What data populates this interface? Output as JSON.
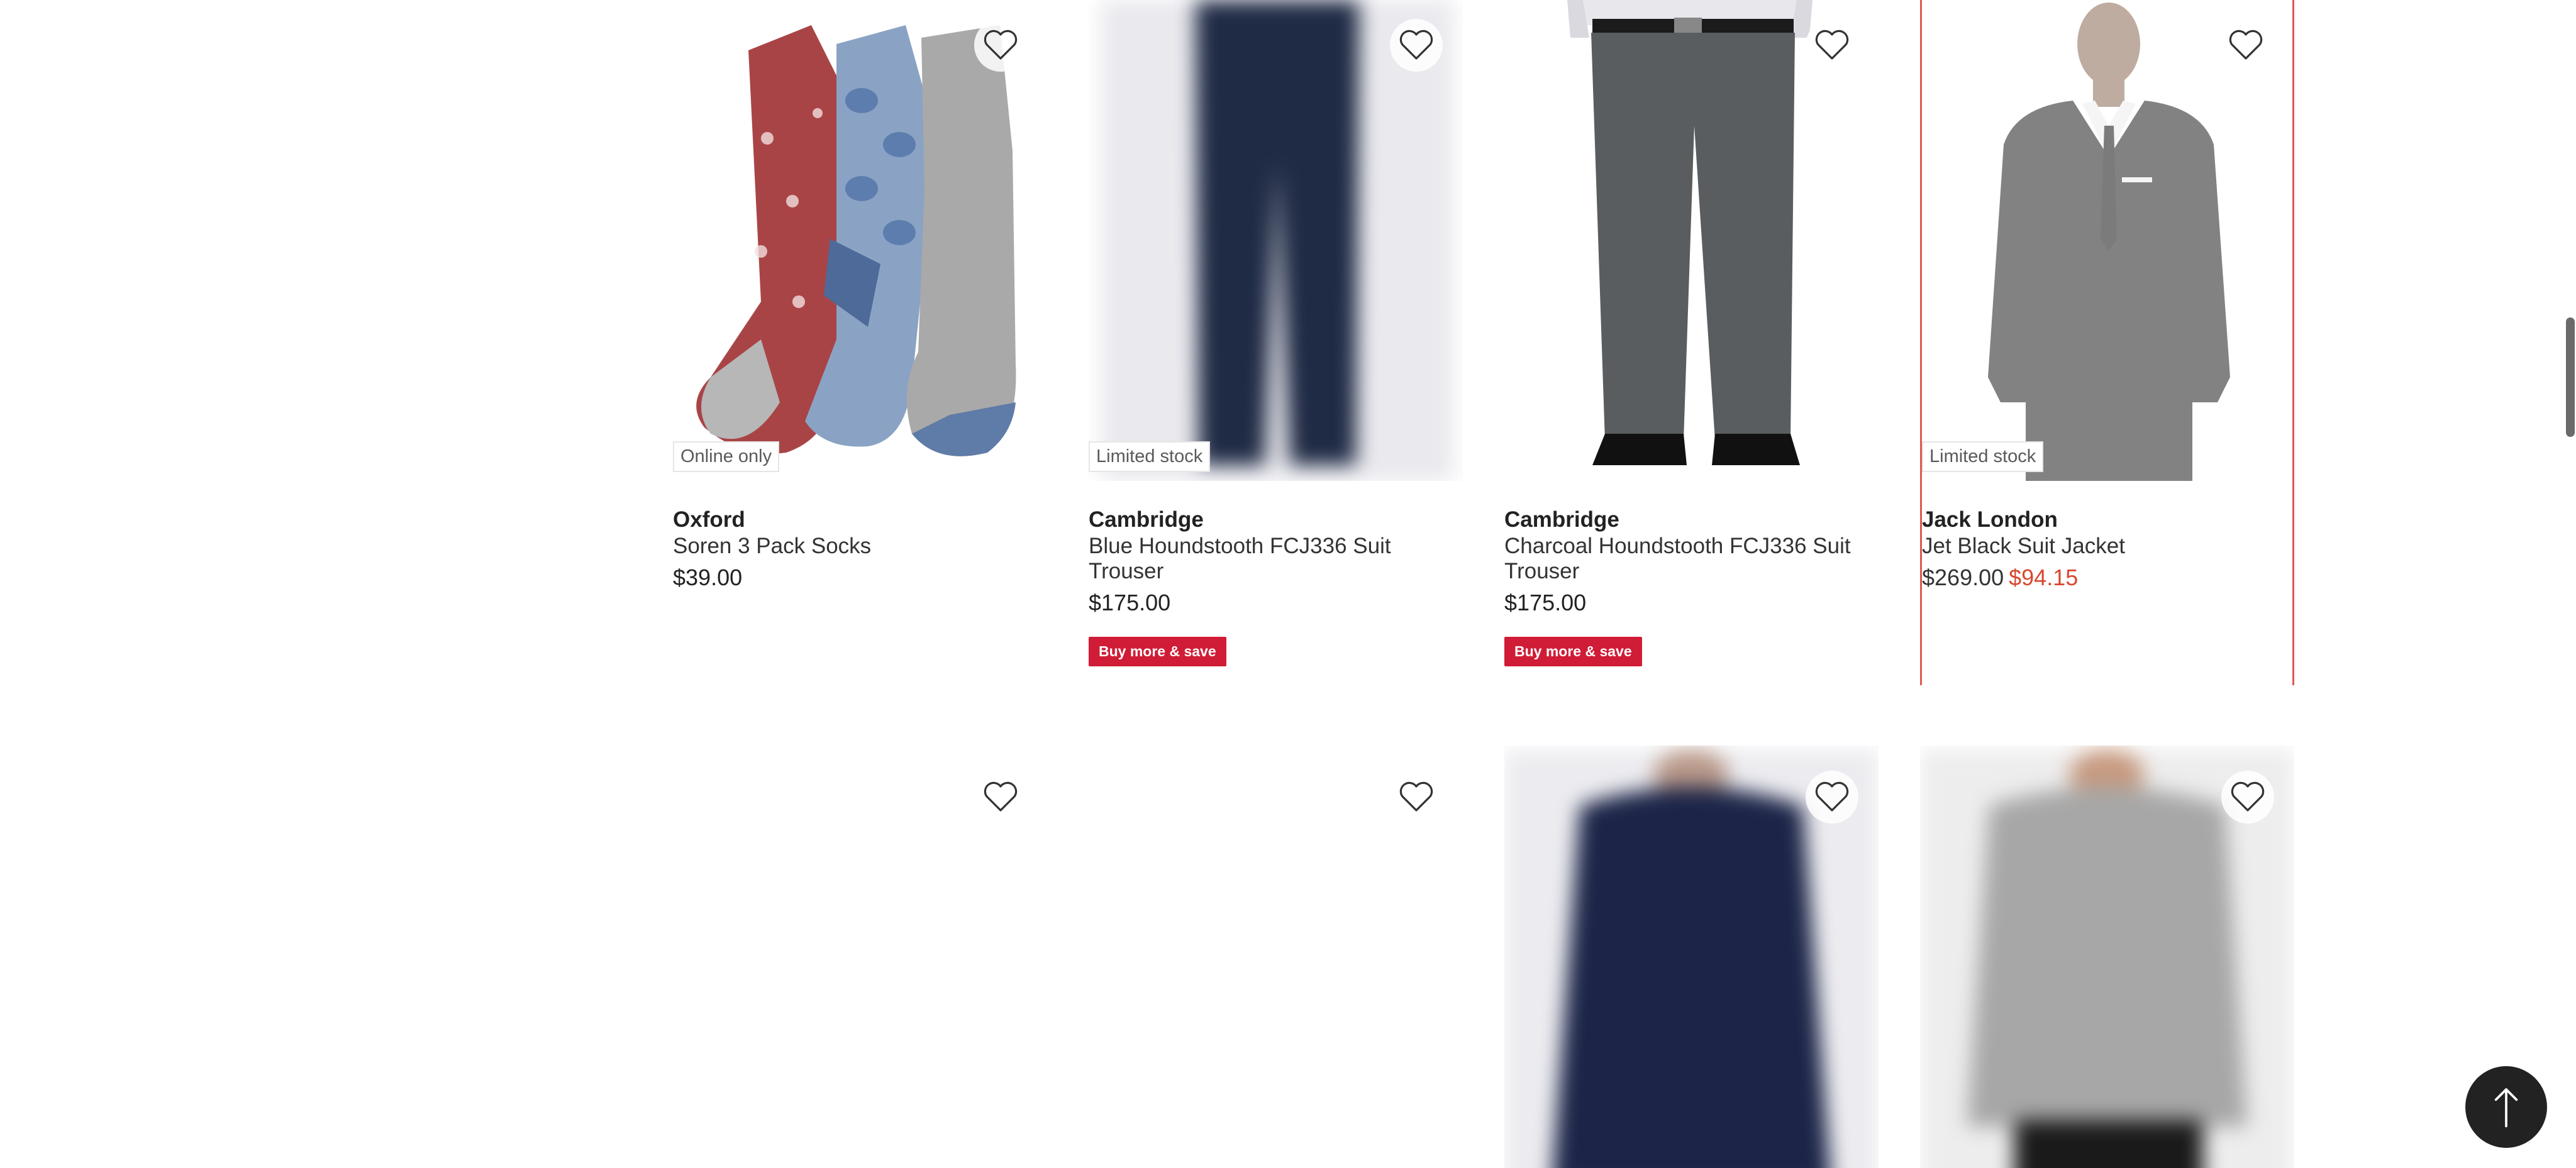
{
  "products": [
    {
      "badge": "Online only",
      "brand": "Oxford",
      "name": "Soren 3 Pack Socks",
      "price": "$39.00",
      "image_icon": "socks-image"
    },
    {
      "badge": "Limited stock",
      "brand": "Cambridge",
      "name": "Blue Houndstooth FCJ336 Suit Trouser",
      "price": "$175.00",
      "promo": "Buy more & save",
      "image_icon": "trouser-image"
    },
    {
      "brand": "Cambridge",
      "name": "Charcoal Houndstooth FCJ336 Suit Trouser",
      "price": "$175.00",
      "promo": "Buy more & save",
      "image_icon": "trouser-image"
    },
    {
      "badge": "Limited stock",
      "brand": "Jack London",
      "name": "Jet Black Suit Jacket",
      "price_was": "$269.00",
      "price_now": "$94.15",
      "image_icon": "suit-jacket-image"
    },
    {
      "image_icon": "blank-image"
    },
    {
      "image_icon": "blank-image"
    },
    {
      "image_icon": "navy-sweater-image"
    },
    {
      "image_icon": "grey-sweater-image"
    }
  ],
  "icons": {
    "favorite": "heart-outline-icon",
    "back_to_top": "arrow-up-icon"
  },
  "colors": {
    "sale_price": "#d6482e",
    "promo_badge": "#d01c36",
    "selected_border": "#e0584f",
    "back_to_top_bg": "#222222"
  }
}
